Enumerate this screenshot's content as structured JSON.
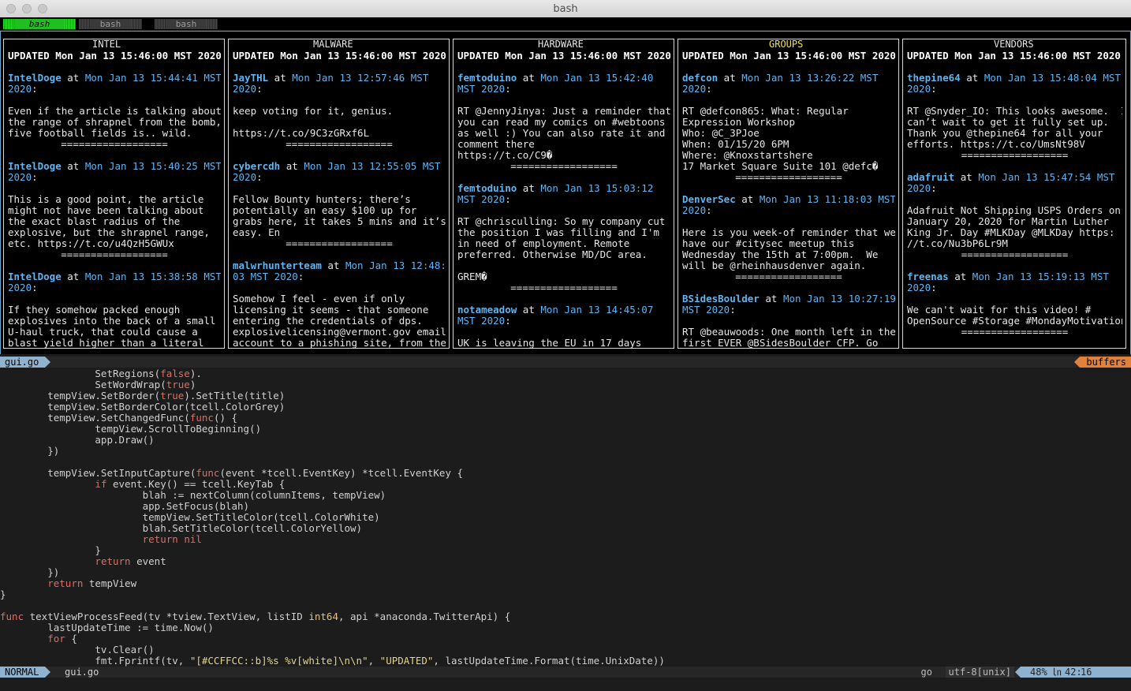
{
  "window": {
    "title": "bash"
  },
  "tabs": [
    {
      "label": "bash",
      "active": true
    },
    {
      "label": "bash",
      "active": false
    },
    {
      "label": "bash",
      "active": false
    }
  ],
  "columns": [
    {
      "title": "INTEL",
      "updated": "UPDATED Mon Jan 13 15:46:00 MST 2020",
      "tweets": [
        {
          "user": "IntelDoge",
          "at": " at ",
          "date": "Mon Jan 13 15:44:41 MST\n2020",
          "text": "Even if the article is talking about\nthe range of shrapnel from the bomb,\nfive football fields is.. wild."
        },
        {
          "user": "IntelDoge",
          "at": " at ",
          "date": "Mon Jan 13 15:40:25 MST\n2020",
          "text": "This is a good point, the article\nmight not have been talking about\nthe exact blast radius of the\nexplosive, but the shrapnel range,\netc. https://t.co/u4QzH5GWUx"
        },
        {
          "user": "IntelDoge",
          "at": " at ",
          "date": "Mon Jan 13 15:38:58 MST\n2020",
          "text": "If they somehow packed enough\nexplosives into the back of a small\nU-haul truck, that could cause a\nblast yield higher than a literal"
        }
      ]
    },
    {
      "title": "MALWARE",
      "updated": "UPDATED Mon Jan 13 15:46:00 MST 2020",
      "tweets": [
        {
          "user": "JayTHL",
          "at": " at ",
          "date": "Mon Jan 13 12:57:46 MST\n2020",
          "text": "keep voting for it, genius.\n\nhttps://t.co/9C3zGRxf6L"
        },
        {
          "user": "cybercdh",
          "at": " at ",
          "date": "Mon Jan 13 12:55:05 MST\n2020",
          "text": "Fellow Bounty hunters; there’s\npotentially an easy $100 up for\ngrabs here, it takes 5 mins and it’s\neasy. En"
        },
        {
          "user": "malwrhunterteam",
          "at": " at ",
          "date": "Mon Jan 13 12:48:\n03 MST 2020",
          "text": "Somehow I feel - even if only\nlicensing it seems - that someone\nentering the credentials of dps.\nexplosivelicensing@vermont.gov email\naccount to a phishing site, from the"
        }
      ]
    },
    {
      "title": "HARDWARE",
      "updated": "UPDATED Mon Jan 13 15:46:00 MST 2020",
      "tweets": [
        {
          "user": "femtoduino",
          "at": " at ",
          "date": "Mon Jan 13 15:42:40\nMST 2020",
          "text": "RT @JennyJinya: Just a reminder that\nyou can read my comics on #webtoons\nas well :) You can also rate it and\ncomment there\nhttps://t.co/C9�"
        },
        {
          "user": "femtoduino",
          "at": " at ",
          "date": "Mon Jan 13 15:03:12\nMST 2020",
          "text": "RT @chrisculling: So my company cut\nthe position I was filling and I'm\nin need of employment. Remote\npreferred. Otherwise MD/DC area.\n\nGREM�"
        },
        {
          "user": "notameadow",
          "at": " at ",
          "date": "Mon Jan 13 14:45:07\nMST 2020",
          "text": "UK is leaving the EU in 17 days"
        }
      ]
    },
    {
      "title": "GROUPS",
      "updated": "UPDATED Mon Jan 13 15:46:00 MST 2020",
      "tweets": [
        {
          "user": "defcon",
          "at": " at ",
          "date": "Mon Jan 13 13:26:22 MST\n2020",
          "text": "RT @defcon865: What: Regular\nExpression Workshop\nWho: @C_3PJoe\nWhen: 01/15/20 6PM\nWhere: @Knoxstartshere\n17 Market Square Suite 101 @defc�"
        },
        {
          "user": "DenverSec",
          "at": " at ",
          "date": "Mon Jan 13 11:18:03 MST\n2020",
          "text": "Here is you week-of reminder that we\nhave our #citysec meetup this\nWednesday the 15th at 7:00pm.  We\nwill be @rheinhausdenver again."
        },
        {
          "user": "BSidesBoulder",
          "at": " at ",
          "date": "Mon Jan 13 10:27:19\nMST 2020",
          "text": "RT @beauwoods: One month left in the\nfirst EVER @BSidesBoulder CFP. Go"
        }
      ]
    },
    {
      "title": "VENDORS",
      "updated": "UPDATED Mon Jan 13 15:46:00 MST 2020",
      "tweets": [
        {
          "user": "thepine64",
          "at": " at ",
          "date": "Mon Jan 13 15:48:04 MST\n2020",
          "text": "RT @Snyder_IO: This looks awesome.  I\ncan’t wait to get it fully set up.\nThank you @thepine64 for all your\nefforts. https://t.co/UmsNt98V"
        },
        {
          "user": "adafruit",
          "at": " at ",
          "date": "Mon Jan 13 15:47:54 MST\n2020",
          "text": "Adafruit Not Shipping USPS Orders on\nJanuary 20, 2020 for Martin Luther\nKing Jr. Day #MLKDay @MLKDay https:\n//t.co/Nu3bP6Lr9M"
        },
        {
          "user": "freenas",
          "at": " at ",
          "date": "Mon Jan 13 15:19:13 MST\n2020",
          "text": "We can't wait for this video! #\nOpenSource #Storage #MondayMotivation"
        }
      ]
    }
  ],
  "separator": "==================",
  "editor": {
    "window_file": "gui.go",
    "buffers_label": "buffers",
    "code_lines": [
      [
        [
          "",
          "                SetRegions("
        ],
        [
          "kw",
          "false"
        ],
        [
          "",
          ")."
        ]
      ],
      [
        [
          "",
          "                SetWordWrap("
        ],
        [
          "kw",
          "true"
        ],
        [
          "",
          ")"
        ]
      ],
      [
        [
          "",
          "        tempView.SetBorder("
        ],
        [
          "kw",
          "true"
        ],
        [
          "",
          ").SetTitle(title)"
        ]
      ],
      [
        [
          "",
          "        tempView.SetBorderColor(tcell.ColorGrey)"
        ]
      ],
      [
        [
          "",
          "        tempView.SetChangedFunc("
        ],
        [
          "kw",
          "func"
        ],
        [
          "",
          "() {"
        ]
      ],
      [
        [
          "",
          "                tempView.ScrollToBeginning()"
        ]
      ],
      [
        [
          "",
          "                app.Draw()"
        ]
      ],
      [
        [
          "",
          "        })"
        ]
      ],
      [
        [
          "",
          ""
        ]
      ],
      [
        [
          "",
          "        tempView.SetInputCapture("
        ],
        [
          "kw",
          "func"
        ],
        [
          "",
          "(event *tcell.EventKey) *tcell.EventKey {"
        ]
      ],
      [
        [
          "",
          "                "
        ],
        [
          "kw",
          "if"
        ],
        [
          "",
          " event.Key() == tcell.KeyTab {"
        ]
      ],
      [
        [
          "",
          "                        blah := nextColumn(columnItems, tempView)"
        ]
      ],
      [
        [
          "",
          "                        app.SetFocus(blah)"
        ]
      ],
      [
        [
          "",
          "                        tempView.SetTitleColor(tcell.ColorWhite)"
        ]
      ],
      [
        [
          "",
          "                        blah.SetTitleColor(tcell.ColorYellow)"
        ]
      ],
      [
        [
          "",
          "                        "
        ],
        [
          "kw",
          "return"
        ],
        [
          "",
          " "
        ],
        [
          "kw",
          "nil"
        ]
      ],
      [
        [
          "",
          "                }"
        ]
      ],
      [
        [
          "",
          "                "
        ],
        [
          "kw",
          "return"
        ],
        [
          "",
          " event"
        ]
      ],
      [
        [
          "",
          "        })"
        ]
      ],
      [
        [
          "",
          "        "
        ],
        [
          "kw",
          "return"
        ],
        [
          "",
          " tempView"
        ]
      ],
      [
        [
          "",
          "}"
        ]
      ],
      [
        [
          "",
          ""
        ]
      ],
      [
        [
          "kw",
          "func"
        ],
        [
          "",
          " textViewProcessFeed(tv *tview.TextView, listID "
        ],
        [
          "ty",
          "int64"
        ],
        [
          "",
          ", api *anaconda.TwitterApi) {"
        ]
      ],
      [
        [
          "",
          "        lastUpdateTime := time.Now()"
        ]
      ],
      [
        [
          "",
          "        "
        ],
        [
          "kw",
          "for"
        ],
        [
          "",
          " {"
        ]
      ],
      [
        [
          "",
          "                tv.Clear()"
        ]
      ],
      [
        [
          "",
          "                fmt.Fprintf(tv, "
        ],
        [
          "str",
          "\"[#CCFFCC::b]%s %v[white]\\n\\n\""
        ],
        [
          "",
          ", "
        ],
        [
          "str",
          "\"UPDATED\""
        ],
        [
          "",
          ", lastUpdateTime.Format(time.UnixDate))"
        ]
      ]
    ],
    "status": {
      "mode": "NORMAL",
      "file": "gui.go",
      "filetype": "go",
      "encoding": "utf-8[unix]",
      "percent": "48%",
      "line_icon": "㏑",
      "line": "42:",
      "col": "16"
    }
  },
  "colors": {
    "link_blue": "#5fb4f2",
    "focus_title": "#f5e642",
    "tab_active": "#1fbf1f",
    "statusline_accent": "#8fb3cf",
    "buffers_accent": "#e2823a",
    "keyword": "#e56a5e"
  }
}
